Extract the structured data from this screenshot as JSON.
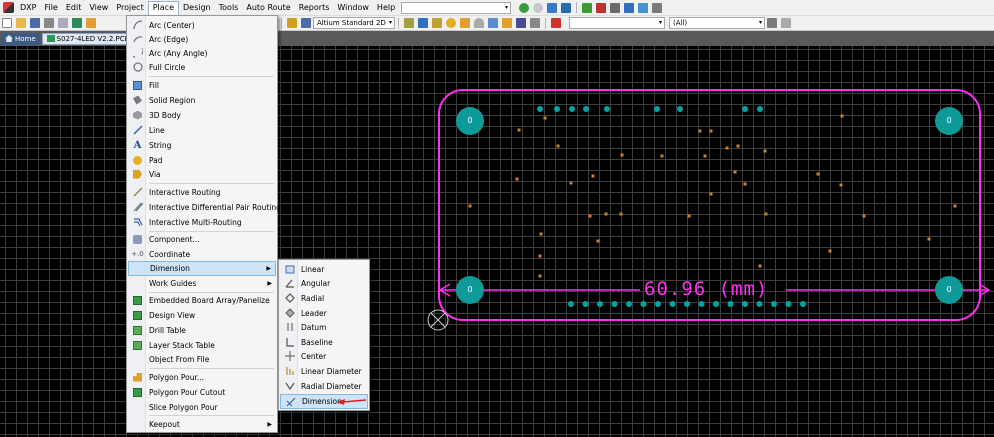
{
  "menubar": {
    "items": [
      {
        "id": "dxp",
        "label": "DXP"
      },
      {
        "id": "file",
        "label": "File"
      },
      {
        "id": "edit",
        "label": "Edit"
      },
      {
        "id": "view",
        "label": "View"
      },
      {
        "id": "project",
        "label": "Project"
      },
      {
        "id": "place",
        "label": "Place"
      },
      {
        "id": "design",
        "label": "Design"
      },
      {
        "id": "tools",
        "label": "Tools"
      },
      {
        "id": "auto-route",
        "label": "Auto Route"
      },
      {
        "id": "reports",
        "label": "Reports"
      },
      {
        "id": "window",
        "label": "Window"
      },
      {
        "id": "help",
        "label": "Help"
      }
    ]
  },
  "toolbar": {
    "view_combo": "Altium Standard 2D",
    "layer_combo": "",
    "filter_combo": "(All)"
  },
  "tabs": {
    "home": "Home",
    "document": "S027-4LED V2.2.PCB *"
  },
  "place_menu": {
    "items": [
      {
        "label": "Arc (Center)",
        "icon": "arc-center-icon"
      },
      {
        "label": "Arc (Edge)",
        "icon": "arc-edge-icon"
      },
      {
        "label": "Arc (Any Angle)",
        "icon": "arc-any-angle-icon"
      },
      {
        "label": "Full Circle",
        "icon": "full-circle-icon"
      },
      {
        "label": "Fill",
        "icon": "fill-icon"
      },
      {
        "label": "Solid Region",
        "icon": "solid-region-icon"
      },
      {
        "label": "3D Body",
        "icon": "3d-body-icon"
      },
      {
        "label": "Line",
        "icon": "line-icon"
      },
      {
        "label": "String",
        "icon": "string-icon"
      },
      {
        "label": "Pad",
        "icon": "pad-icon"
      },
      {
        "label": "Via",
        "icon": "via-icon"
      },
      {
        "label": "Interactive Routing",
        "icon": "interactive-routing-icon"
      },
      {
        "label": "Interactive Differential Pair Routing",
        "icon": "diff-pair-routing-icon"
      },
      {
        "label": "Interactive Multi-Routing",
        "icon": "multi-routing-icon"
      },
      {
        "label": "Component...",
        "icon": "component-icon"
      },
      {
        "label": "Coordinate",
        "icon": "coordinate-icon"
      },
      {
        "label": "Dimension",
        "icon": "",
        "submenu": true
      },
      {
        "label": "Work Guides",
        "icon": "",
        "submenu": true
      },
      {
        "label": "Embedded Board Array/Panelize",
        "icon": "board-array-icon"
      },
      {
        "label": "Design View",
        "icon": "design-view-icon"
      },
      {
        "label": "Drill Table",
        "icon": "drill-table-icon"
      },
      {
        "label": "Layer Stack Table",
        "icon": "layer-stack-table-icon"
      },
      {
        "label": "Object From File",
        "icon": ""
      },
      {
        "label": "Polygon Pour...",
        "icon": "polygon-pour-icon"
      },
      {
        "label": "Polygon Pour Cutout",
        "icon": "polygon-cutout-icon"
      },
      {
        "label": "Slice Polygon Pour",
        "icon": ""
      },
      {
        "label": "Keepout",
        "icon": "",
        "submenu": true
      }
    ]
  },
  "dimension_menu": {
    "items": [
      {
        "label": "Linear",
        "icon": "linear-dimension-icon"
      },
      {
        "label": "Angular",
        "icon": "angular-dimension-icon"
      },
      {
        "label": "Radial",
        "icon": "radial-dimension-icon"
      },
      {
        "label": "Leader",
        "icon": "leader-dimension-icon"
      },
      {
        "label": "Datum",
        "icon": "datum-dimension-icon"
      },
      {
        "label": "Baseline",
        "icon": "baseline-dimension-icon"
      },
      {
        "label": "Center",
        "icon": "center-dimension-icon"
      },
      {
        "label": "Linear Diameter",
        "icon": "linear-diameter-icon"
      },
      {
        "label": "Radial Diameter",
        "icon": "radial-diameter-icon"
      },
      {
        "label": "Dimension",
        "icon": "dimension-icon"
      }
    ]
  },
  "pcb": {
    "dimension_text": "60.96 (mm)",
    "pad_label": "0",
    "colors": {
      "outline": "#ff2ef0",
      "pad": "#0f9a9a",
      "hole_pad": "#00a5a5",
      "via": "#d08030",
      "arrow": "#e02020"
    }
  }
}
